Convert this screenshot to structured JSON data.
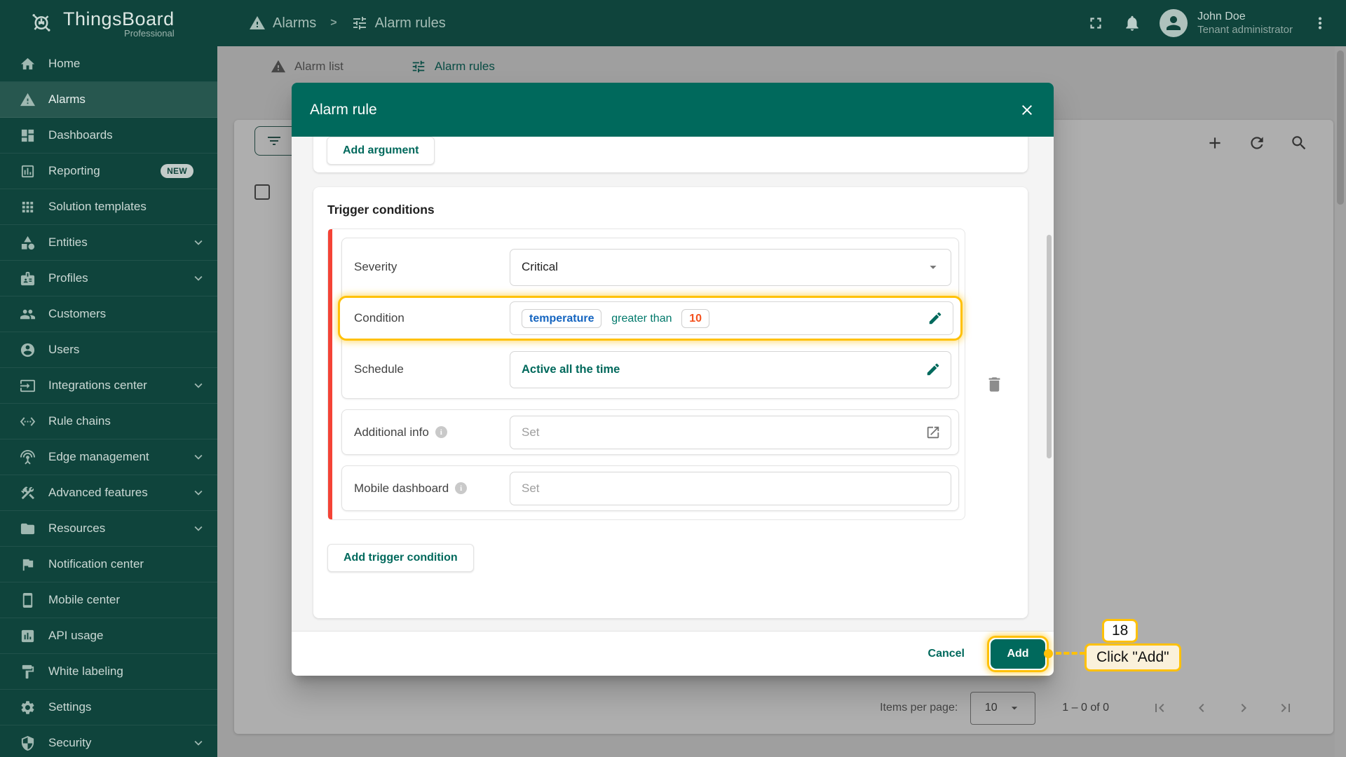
{
  "colors": {
    "accent": "#00695C",
    "sidebar_bg": "#0F443C",
    "highlight": "#FFC107",
    "danger_bar": "#F44336",
    "chip_argument": "#1565C0",
    "chip_value": "#F4511E",
    "operator": "#00796B"
  },
  "header": {
    "product": "ThingsBoard",
    "edition": "Professional",
    "breadcrumb": [
      {
        "icon": "warning",
        "label": "Alarms"
      },
      {
        "icon": "tune",
        "label": "Alarm rules"
      }
    ],
    "breadcrumb_separator": ">",
    "user": {
      "name": "John Doe",
      "role": "Tenant administrator"
    }
  },
  "sidebar": {
    "items": [
      {
        "label": "Home",
        "icon": "home"
      },
      {
        "label": "Alarms",
        "icon": "warning",
        "selected": true
      },
      {
        "label": "Dashboards",
        "icon": "dashboard"
      },
      {
        "label": "Reporting",
        "icon": "reporting",
        "badge": "NEW"
      },
      {
        "label": "Solution templates",
        "icon": "apps"
      },
      {
        "label": "Entities",
        "icon": "category",
        "expandable": true
      },
      {
        "label": "Profiles",
        "icon": "badge",
        "expandable": true
      },
      {
        "label": "Customers",
        "icon": "people"
      },
      {
        "label": "Users",
        "icon": "person"
      },
      {
        "label": "Integrations center",
        "icon": "input",
        "expandable": true
      },
      {
        "label": "Rule chains",
        "icon": "ethernet"
      },
      {
        "label": "Edge management",
        "icon": "antenna",
        "expandable": true
      },
      {
        "label": "Advanced features",
        "icon": "construction",
        "expandable": true
      },
      {
        "label": "Resources",
        "icon": "folder",
        "expandable": true
      },
      {
        "label": "Notification center",
        "icon": "flag"
      },
      {
        "label": "Mobile center",
        "icon": "smartphone"
      },
      {
        "label": "API usage",
        "icon": "chart"
      },
      {
        "label": "White labeling",
        "icon": "paint"
      },
      {
        "label": "Settings",
        "icon": "gear"
      },
      {
        "label": "Security",
        "icon": "shield",
        "expandable": true
      }
    ]
  },
  "content": {
    "tabs": [
      {
        "icon": "warning",
        "label": "Alarm list",
        "active": false
      },
      {
        "icon": "tune",
        "label": "Alarm rules",
        "active": true
      }
    ],
    "toolbar_icons": [
      "plus",
      "refresh",
      "search"
    ],
    "pagination": {
      "items_per_page_label": "Items per page:",
      "page_size": "10",
      "range": "1 – 0 of 0",
      "pager_icons": [
        "first-page",
        "chevron-left",
        "chevron-right",
        "last-page"
      ]
    }
  },
  "modal": {
    "title": "Alarm rule",
    "add_argument_label": "Add argument",
    "section_title": "Trigger conditions",
    "severity": {
      "label": "Severity",
      "value": "Critical"
    },
    "condition": {
      "label": "Condition",
      "argument": "temperature",
      "operator": "greater than",
      "value": "10"
    },
    "schedule": {
      "label": "Schedule",
      "value": "Active all the time"
    },
    "additional_info": {
      "label": "Additional info",
      "placeholder": "Set"
    },
    "mobile_dashboard": {
      "label": "Mobile dashboard",
      "placeholder": "Set"
    },
    "add_trigger_condition_label": "Add trigger condition",
    "cancel_label": "Cancel",
    "add_label": "Add"
  },
  "annotation": {
    "step": "18",
    "label": "Click \"Add\""
  }
}
